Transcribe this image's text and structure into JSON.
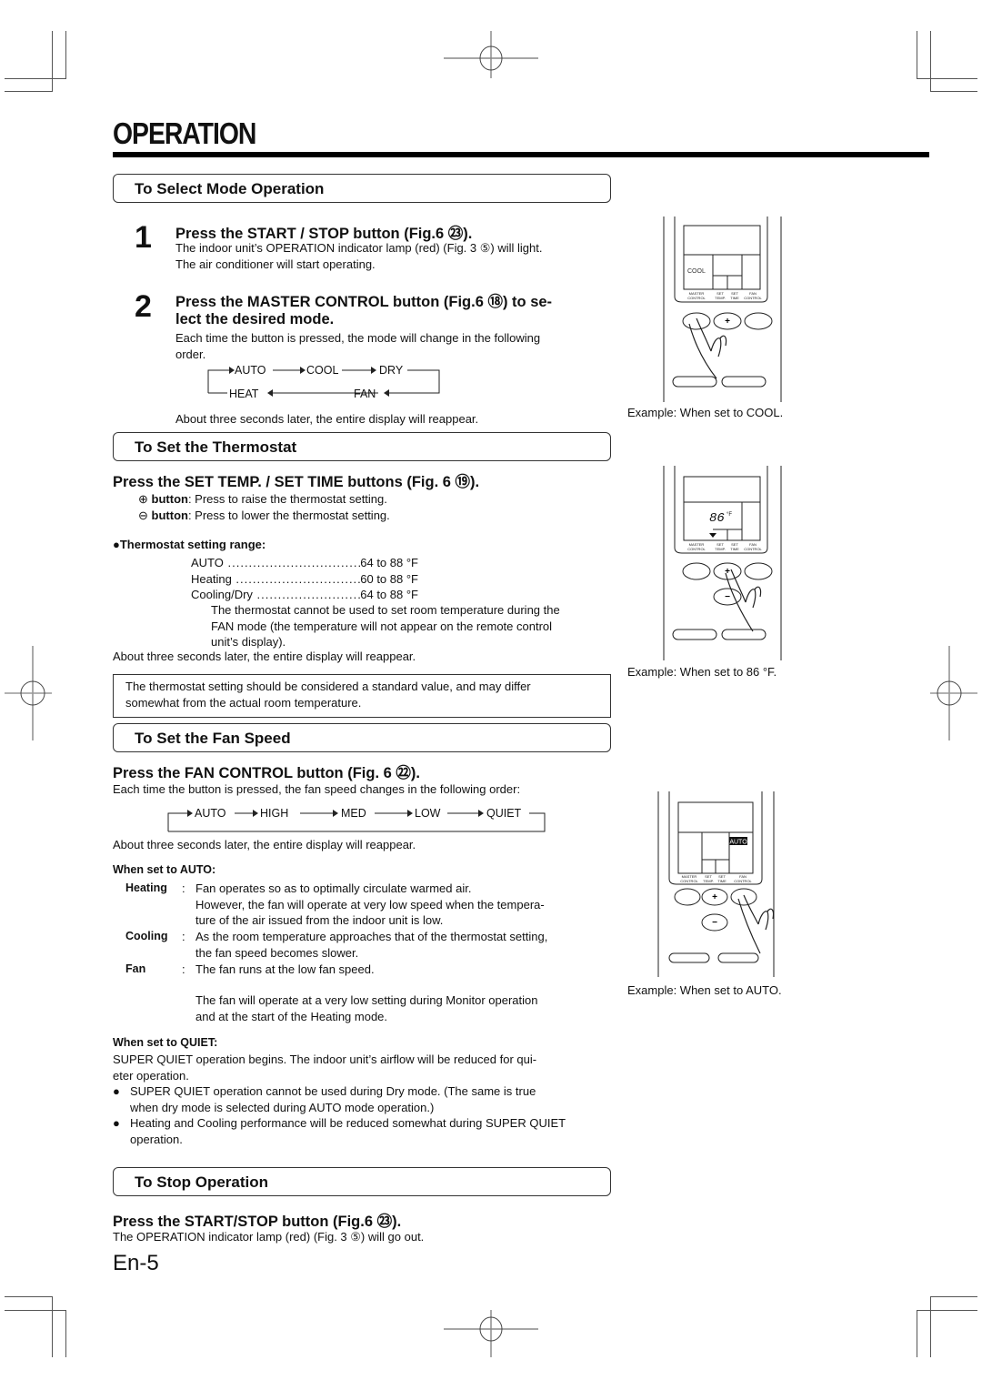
{
  "page": {
    "title": "OPERATION",
    "page_number": "En-5"
  },
  "select_mode": {
    "section_title": "To Select Mode Operation",
    "step1": {
      "number": "1",
      "heading": "Press the START / STOP button (Fig.6 ㉓).",
      "line1": "The indoor unit’s OPERATION indicator lamp (red) (Fig. 3 ⑤) will light.",
      "line2": "The air conditioner will start operating."
    },
    "step2": {
      "number": "2",
      "heading_line1": "Press the MASTER CONTROL button (Fig.6 ⑱) to se-",
      "heading_line2": "lect the desired mode.",
      "line1": "Each time the button is pressed, the mode will change in the following",
      "line2": "order.",
      "modes": [
        "AUTO",
        "COOL",
        "DRY",
        "FAN",
        "HEAT"
      ],
      "after": "About three seconds later, the entire display will reappear."
    },
    "figure_caption": "Example: When set to COOL.",
    "display_mode": "COOL"
  },
  "thermostat": {
    "section_title": "To Set the Thermostat",
    "heading": "Press the SET TEMP. / SET TIME buttons (Fig. 6 ⑲).",
    "plus_label": "button",
    "plus_text": ": Press to raise the thermostat setting.",
    "minus_label": "button",
    "minus_text": ": Press to lower the thermostat setting.",
    "range_title": "Thermostat setting range",
    "ranges": [
      {
        "mode": "AUTO",
        "value": "64 to 88 °F"
      },
      {
        "mode": "Heating",
        "value": "60 to 88 °F"
      },
      {
        "mode": "Cooling/Dry",
        "value": "64 to 88 °F"
      }
    ],
    "fan_note_1": "The thermostat cannot be used to set room temperature during the",
    "fan_note_2": "FAN mode (the temperature will not appear on the remote control",
    "fan_note_3": "unit’s display).",
    "after": "About three seconds later, the entire display will reappear.",
    "note_box_1": "The thermostat setting should be considered a standard value, and may differ",
    "note_box_2": "somewhat from the actual room temperature.",
    "figure_caption": "Example: When set to 86 °F.",
    "display_temp": "86",
    "display_unit": "°F"
  },
  "fan_speed": {
    "section_title": "To Set the Fan Speed",
    "heading": "Press the FAN CONTROL button (Fig. 6 ㉒).",
    "intro": "Each time the button is pressed, the fan speed changes in the following order:",
    "speeds": [
      "AUTO",
      "HIGH",
      "MED",
      "LOW",
      "QUIET"
    ],
    "after": "About three seconds later, the entire display will reappear.",
    "auto_title": "When set to AUTO",
    "auto_items": [
      {
        "label": "Heating",
        "lines": [
          "Fan operates so as to optimally circulate warmed air.",
          "However, the fan will operate at very low speed when the tempera-",
          "ture of the air issued from the indoor unit is low."
        ]
      },
      {
        "label": "Cooling",
        "lines": [
          "As the room temperature approaches that of the thermostat setting,",
          "the fan speed becomes slower."
        ]
      },
      {
        "label": "Fan",
        "lines": [
          "The fan runs at the low fan speed."
        ]
      }
    ],
    "monitor_note_1": "The fan will operate at a very low setting during Monitor operation",
    "monitor_note_2": "and at the start of the Heating mode.",
    "quiet_title": "When set to QUIET",
    "quiet_line1": "SUPER QUIET operation begins. The indoor unit’s airflow will be reduced for qui-",
    "quiet_line2": "eter operation.",
    "bullet1_line1": "SUPER QUIET operation cannot be used during Dry mode. (The same is true",
    "bullet1_line2": "when dry mode is selected during AUTO mode operation.)",
    "bullet2_line1": "Heating and Cooling performance will be reduced somewhat during SUPER QUIET",
    "bullet2_line2": "operation.",
    "figure_caption": "Example: When set to AUTO.",
    "display_fan": "AUTO"
  },
  "stop": {
    "section_title": "To Stop Operation",
    "heading": "Press the START/STOP button (Fig.6 ㉓).",
    "line1": "The OPERATION indicator lamp (red) (Fig. 3 ⑤) will go out."
  },
  "remote_labels": {
    "master": [
      "MASTER",
      "CONTROL"
    ],
    "set_temp": [
      "SET",
      "TEMP."
    ],
    "set_time": [
      "SET",
      "TIME"
    ],
    "fan": [
      "FAN",
      "CONTROL"
    ],
    "plus": "+",
    "minus": "−"
  }
}
